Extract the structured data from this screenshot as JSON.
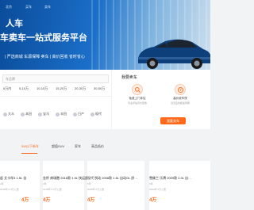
{
  "topnav": {
    "items": [
      "北京",
      "买车",
      "卖车"
    ]
  },
  "hero": {
    "line1": "人车",
    "line2": "车卖车一站式服务平台",
    "tags": "| 严选商城  车源保障  卖车 | 高价回收  省时省心"
  },
  "search": {
    "placeholder": "车品牌",
    "price_ranges": [
      "5万内",
      "5-10万",
      "10-15万",
      "15-20万",
      "20-30万",
      "30-50万"
    ],
    "brands": [
      "大众",
      "本田",
      "宝马",
      "丰田",
      "日产",
      "现代"
    ]
  },
  "sell": {
    "title": "我要卖车",
    "services": [
      {
        "title": "免费上门评估",
        "sub": "专业评估高价回收"
      },
      {
        "title": "高价收车快",
        "sub": "当天签约极速到账"
      }
    ],
    "button": "我要卖车"
  },
  "tabs": {
    "items": [
      "5W以下新车",
      "超值SUV",
      "家车",
      "高品低价"
    ],
    "active_index": 0,
    "accent_color": "#ff6a1a"
  },
  "cars": [
    {
      "name": "起 艾卡伴3 1.5L 自",
      "sub": "4年",
      "meta": "2018年 5.3万公里",
      "price": "4万"
    },
    {
      "name": "金杯 商瑞胞 2018款 1.5L 快运舒…",
      "sub": "4年",
      "meta": "2018年 5.3万公里",
      "price": "4万"
    },
    {
      "name": "现代 悦动 2008款 1.6L 自动GL 舒…",
      "sub": "5年",
      "meta": "2008年 5万公里",
      "price": "4万"
    },
    {
      "name": "雪佛兰 乐骋 2009款 2.0L 自…",
      "sub": "5年",
      "meta": "2009年 5万公里",
      "price": "4万"
    }
  ]
}
